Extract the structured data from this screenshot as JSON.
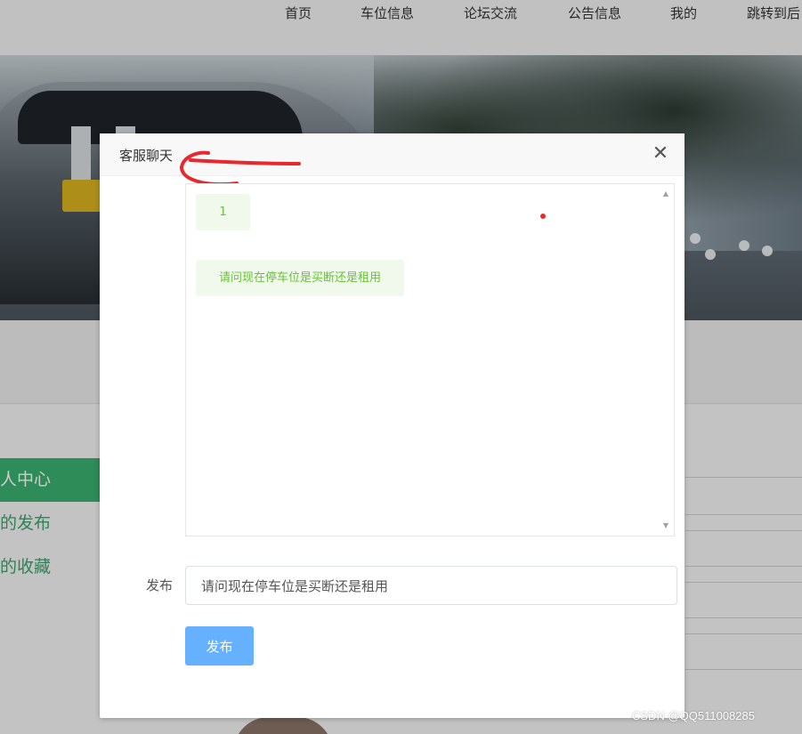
{
  "nav": {
    "items": [
      "首页",
      "车位信息",
      "论坛交流",
      "公告信息",
      "我的",
      "跳转到后"
    ]
  },
  "side_menu": {
    "items": [
      "人中心",
      "的发布",
      "的收藏"
    ]
  },
  "dialog": {
    "title": "客服聊天",
    "close_label": "✕",
    "messages": [
      "1",
      "请问现在停车位是买断还是租用"
    ],
    "form_label": "发布",
    "input_value": "请问现在停车位是买断还是租用",
    "submit_label": "发布"
  },
  "watermark": "CSDN @QQ511008285",
  "colors": {
    "accent": "#39b06f",
    "bubble_bg": "#f0f9eb",
    "bubble_text": "#67c23a",
    "button": "#66b1ff",
    "annotation": "#e8282c"
  }
}
